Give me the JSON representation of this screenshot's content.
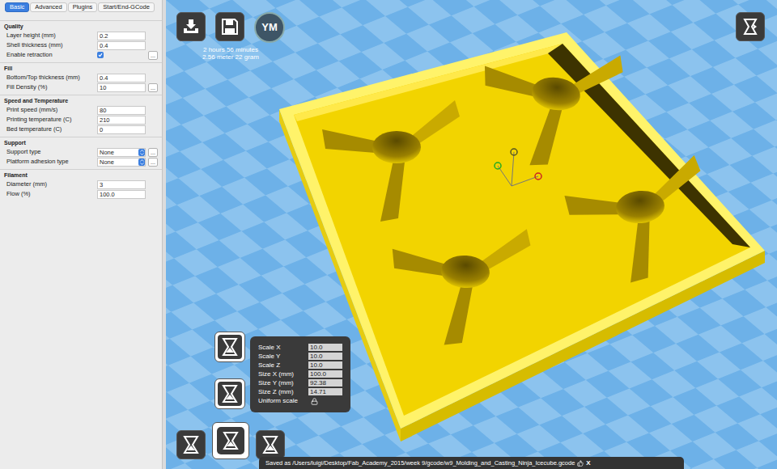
{
  "tabs": [
    {
      "label": "Basic",
      "selected": true
    },
    {
      "label": "Advanced",
      "selected": false
    },
    {
      "label": "Plugins",
      "selected": false
    },
    {
      "label": "Start/End-GCode",
      "selected": false
    }
  ],
  "settings": [
    {
      "heading": "Quality",
      "fields": [
        {
          "kind": "text",
          "label": "Layer height (mm)",
          "value": "0.2"
        },
        {
          "kind": "text",
          "label": "Shell thickness (mm)",
          "value": "0.4"
        },
        {
          "kind": "checkbox",
          "label": "Enable retraction",
          "checked": true,
          "more": "..."
        }
      ]
    },
    {
      "heading": "Fill",
      "fields": [
        {
          "kind": "text",
          "label": "Bottom/Top thickness (mm)",
          "value": "0.4"
        },
        {
          "kind": "text",
          "label": "Fill Density (%)",
          "value": "10",
          "more": "..."
        }
      ]
    },
    {
      "heading": "Speed and Temperature",
      "fields": [
        {
          "kind": "text",
          "label": "Print speed (mm/s)",
          "value": "80"
        },
        {
          "kind": "text",
          "label": "Printing temperature (C)",
          "value": "210"
        },
        {
          "kind": "text",
          "label": "Bed temperature (C)",
          "value": "0"
        }
      ]
    },
    {
      "heading": "Support",
      "fields": [
        {
          "kind": "select",
          "label": "Support type",
          "value": "None",
          "more": "..."
        },
        {
          "kind": "select",
          "label": "Platform adhesion type",
          "value": "None",
          "more": "..."
        }
      ]
    },
    {
      "heading": "Filament",
      "fields": [
        {
          "kind": "text",
          "label": "Diameter (mm)",
          "value": "3"
        },
        {
          "kind": "text",
          "label": "Flow (%)",
          "value": "100.0"
        }
      ]
    }
  ],
  "toolbar": {
    "view_mode_label": "YM"
  },
  "print_estimate": [
    "2 hours 56 minutes",
    "2.56 meter 22 gram"
  ],
  "scale_panel": {
    "fields": [
      {
        "label": "Scale X",
        "value": "10.0"
      },
      {
        "label": "Scale Y",
        "value": "10.0"
      },
      {
        "label": "Scale Z",
        "value": "10.0"
      },
      {
        "label": "Size X (mm)",
        "value": "100.0"
      },
      {
        "label": "Size Y (mm)",
        "value": "92.38"
      },
      {
        "label": "Size Z (mm)",
        "value": "14.71"
      }
    ],
    "uniform_scale": {
      "label": "Uniform scale",
      "locked": true
    }
  },
  "status_bar": {
    "message": "Saved as /Users/luigi/Desktop/Fab_Academy_2015/week 9/gcode/w9_Molding_and_Casting_Ninja_Icecube.gcode",
    "close": "X"
  }
}
